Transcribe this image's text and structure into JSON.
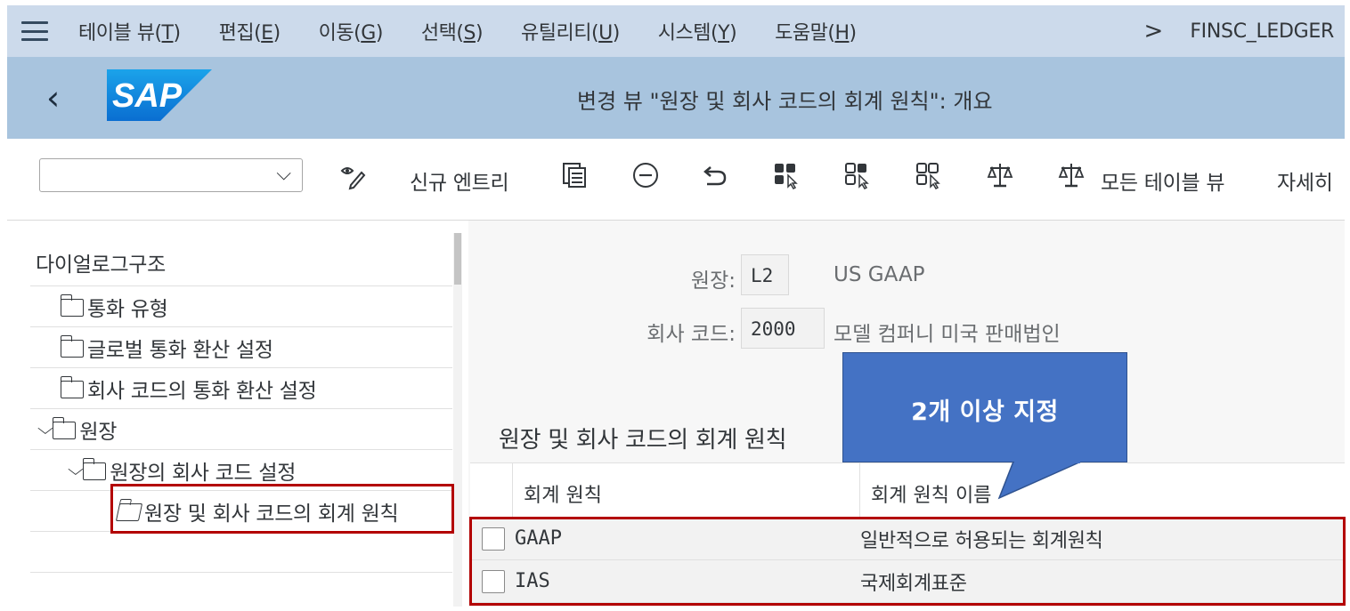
{
  "menubar": {
    "items": [
      {
        "label": "테이블 뷰(",
        "key": "T",
        "end": ")"
      },
      {
        "label": "편집(",
        "key": "E",
        "end": ")"
      },
      {
        "label": "이동(",
        "key": "G",
        "end": ")"
      },
      {
        "label": "선택(",
        "key": "S",
        "end": ")"
      },
      {
        "label": "유틸리티(",
        "key": "U",
        "end": ")"
      },
      {
        "label": "시스템(",
        "key": "Y",
        "end": ")"
      },
      {
        "label": "도움말(",
        "key": "H",
        "end": ")"
      }
    ],
    "chevron": ">",
    "transaction_code": "FINSC_LEDGER"
  },
  "titlebar": {
    "back": "‹",
    "logo_text": "SAP",
    "title": "변경 뷰 \"원장 및 회사 코드의 회계 원칙\": 개요"
  },
  "toolbar": {
    "dropdown_value": "",
    "new_entry": "신규 엔트리",
    "all_table_views": "모든 테이블 뷰",
    "more": "자세히"
  },
  "tree": {
    "header": "다이얼로그구조",
    "items": [
      {
        "label": "통화 유형"
      },
      {
        "label": "글로벌 통화 환산 설정"
      },
      {
        "label": "회사 코드의 통화 환산 설정"
      },
      {
        "label": "원장"
      },
      {
        "label": "원장의 회사 코드 설정"
      },
      {
        "label": "원장 및 회사 코드의 회계 원칙"
      }
    ]
  },
  "form": {
    "ledger_label": "원장:",
    "ledger_value": "L2",
    "ledger_desc": "US GAAP",
    "company_label": "회사 코드:",
    "company_value": "2000",
    "company_desc": "모델 컴퍼니 미국 판매법인"
  },
  "section_title": "원장 및 회사 코드의 회계 원칙",
  "table": {
    "headers": [
      "회계 원칙",
      "회계 원칙 이름"
    ],
    "rows": [
      {
        "code": "GAAP",
        "name": "일반적으로 허용되는 회계원칙"
      },
      {
        "code": "IAS",
        "name": "국제회계표준"
      }
    ]
  },
  "callout": {
    "text": "2개 이상 지정",
    "color": "#4472c4"
  },
  "colors": {
    "menubar": "#ccdaeb",
    "titlebar": "#a8c4de",
    "highlight_border": "#b30000",
    "sap_blue": "#0a6ed1"
  }
}
